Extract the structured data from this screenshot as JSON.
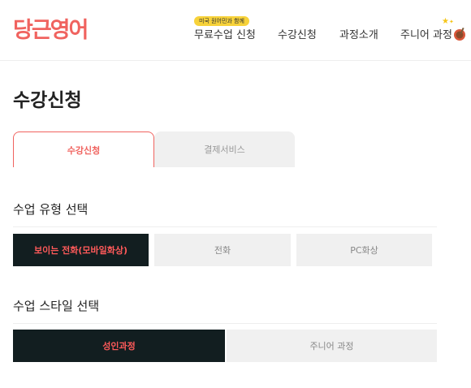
{
  "header": {
    "logo": "당근영어",
    "badge": "미국 원어민과 함께",
    "nav": {
      "free_lesson": "무료수업 신청",
      "apply": "수강신청",
      "course_intro": "과정소개",
      "junior_course": "주니어 과정"
    },
    "stars_icon": "sparkle-stars-icon",
    "bowl_icon": "bowl-icon"
  },
  "page_title": "수강신청",
  "tabs": [
    {
      "label": "수강신청",
      "active": true
    },
    {
      "label": "결제서비스",
      "active": false
    }
  ],
  "lesson_type": {
    "title": "수업 유형 선택",
    "options": [
      {
        "label": "보이는 전화(모바일화상)",
        "selected": true
      },
      {
        "label": "전화",
        "selected": false
      },
      {
        "label": "PC화상",
        "selected": false
      }
    ]
  },
  "lesson_style": {
    "title": "수업 스타일 선택",
    "options": [
      {
        "label": "성인과정",
        "selected": true
      },
      {
        "label": "주니어 과정",
        "selected": false
      }
    ]
  },
  "colors": {
    "brand": "#f0635f",
    "selected_bg": "#121e20",
    "selected_text": "#ff5a5a",
    "unselected_bg": "#f0f0f0"
  }
}
